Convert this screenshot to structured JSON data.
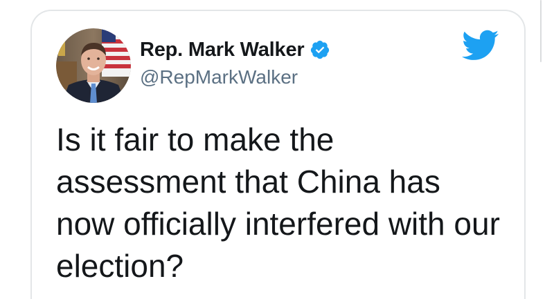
{
  "tweet": {
    "display_name": "Rep. Mark Walker",
    "handle": "@RepMarkWalker",
    "text": "Is it fair to make the assessment that China has now officially interfered with our election?",
    "verified": true
  },
  "icons": {
    "verified": "verified-badge-icon",
    "brand": "twitter-bird-icon"
  },
  "colors": {
    "twitter_blue": "#1da1f2",
    "name_text": "#14171a",
    "handle_text": "#5b7083",
    "border": "#e3e6e8"
  }
}
